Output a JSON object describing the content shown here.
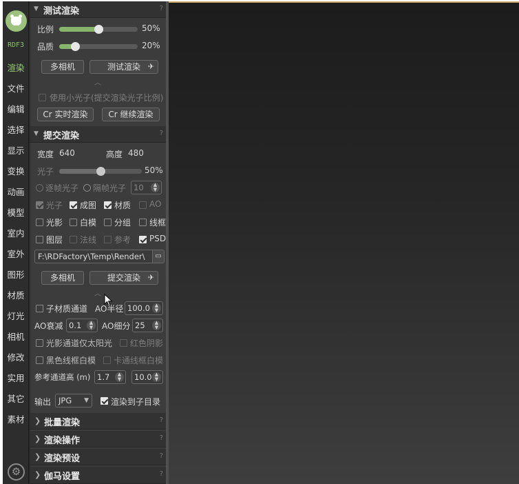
{
  "brand": "RDF3",
  "nav": [
    "渲染",
    "文件",
    "编辑",
    "选择",
    "显示",
    "变换",
    "动画",
    "模型",
    "室内",
    "室外",
    "图形",
    "材质",
    "灯光",
    "相机",
    "修改",
    "实用",
    "其它",
    "素材"
  ],
  "nav_active_index": 0,
  "test_render": {
    "title": "测试渲染",
    "ratio_label": "比例",
    "ratio_value": "50%",
    "ratio_fraction": 0.5,
    "quality_label": "品质",
    "quality_value": "20%",
    "quality_fraction": 0.2,
    "multi_camera": "多相机",
    "test_render_btn": "测试渲染",
    "use_small_photon": "使用小光子(提交渲染光子比例)",
    "cr_realtime": "Cr 实时渲染",
    "cr_continue": "Cr 继续渲染"
  },
  "submit_render": {
    "title": "提交渲染",
    "width_label": "宽度",
    "width_value": "640",
    "height_label": "高度",
    "height_value": "480",
    "photon_label": "光子",
    "photon_value": "50%",
    "photon_fraction": 0.5,
    "per_frame_photon": "逐帧光子",
    "interval_photon": "隔帧光子",
    "interval_value": "10",
    "checks_row1": [
      {
        "label": "光子",
        "state": "disabled-checked"
      },
      {
        "label": "成图",
        "state": "checked"
      },
      {
        "label": "材质",
        "state": "checked"
      },
      {
        "label": "AO",
        "state": "disabled"
      }
    ],
    "checks_row2": [
      {
        "label": "光影",
        "state": "unchecked"
      },
      {
        "label": "白模",
        "state": "unchecked"
      },
      {
        "label": "分组",
        "state": "unchecked"
      },
      {
        "label": "线框",
        "state": "unchecked"
      }
    ],
    "checks_row3": [
      {
        "label": "图层",
        "state": "unchecked"
      },
      {
        "label": "法线",
        "state": "disabled"
      },
      {
        "label": "参考",
        "state": "disabled"
      },
      {
        "label": "PSD",
        "state": "checked"
      }
    ],
    "output_path": "F:\\RDFactory\\Temp\\Render\\",
    "multi_camera": "多相机",
    "submit_btn": "提交渲染",
    "sub_material_channel": "子材质通道",
    "ao_radius_label": "AO半径",
    "ao_radius_value": "100.0",
    "ao_falloff_label": "AO衰减",
    "ao_falloff_value": "0.1",
    "ao_subdiv_label": "AO细分",
    "ao_subdiv_value": "25",
    "shadow_sun_only": "光影通道仅太阳光",
    "red_shadow": "红色阴影",
    "black_wire_white": "黑色线框白模",
    "cartoon_wire_white": "卡通线框白模",
    "ref_channel_height_label": "参考通道高 (m)",
    "ref_height_a": "1.7",
    "ref_height_b": "10.0",
    "output_label": "输出",
    "output_format": "JPG",
    "render_to_subdir": "渲染到子目录"
  },
  "collapsed_sections": [
    "批量渲染",
    "渲染操作",
    "渲染预设",
    "伽马设置"
  ],
  "help_mark": "?",
  "colors": {
    "accent": "#88b56c",
    "panel": "#3c3c3c",
    "viewport_top": "#1c1c1c",
    "viewport_bottom": "#3e3e3e"
  }
}
